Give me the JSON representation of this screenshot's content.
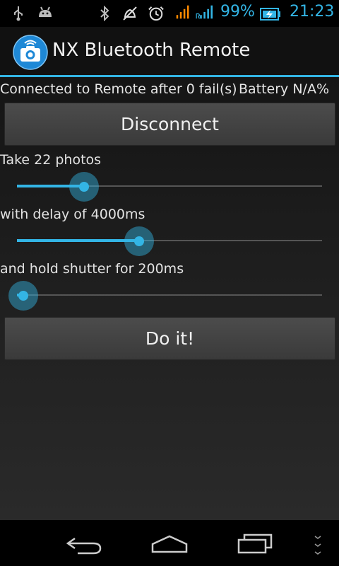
{
  "status_bar": {
    "battery_percent": "99%",
    "time": "21:23",
    "icons": [
      "usb-icon",
      "android-debug-icon",
      "bluetooth-icon",
      "mute-icon",
      "alarm-icon",
      "signal-icon",
      "roaming-signal-icon",
      "battery-charging-icon"
    ],
    "accent": "#33b5e5"
  },
  "action_bar": {
    "title": "NX Bluetooth Remote",
    "icon": "camera-wifi-icon"
  },
  "connection": {
    "status": "Connected to Remote after 0 fail(s)",
    "battery": "Battery N/A%"
  },
  "buttons": {
    "disconnect": "Disconnect",
    "do_it": "Do it!"
  },
  "sliders": [
    {
      "label": "Take 22 photos",
      "level": 0.22
    },
    {
      "label": "with delay of 4000ms",
      "level": 0.4
    },
    {
      "label": "and hold shutter for 200ms",
      "level": 0.02
    }
  ],
  "nav_bar": {
    "icons": [
      "back-icon",
      "home-icon",
      "recent-apps-icon",
      "menu-icon"
    ]
  }
}
